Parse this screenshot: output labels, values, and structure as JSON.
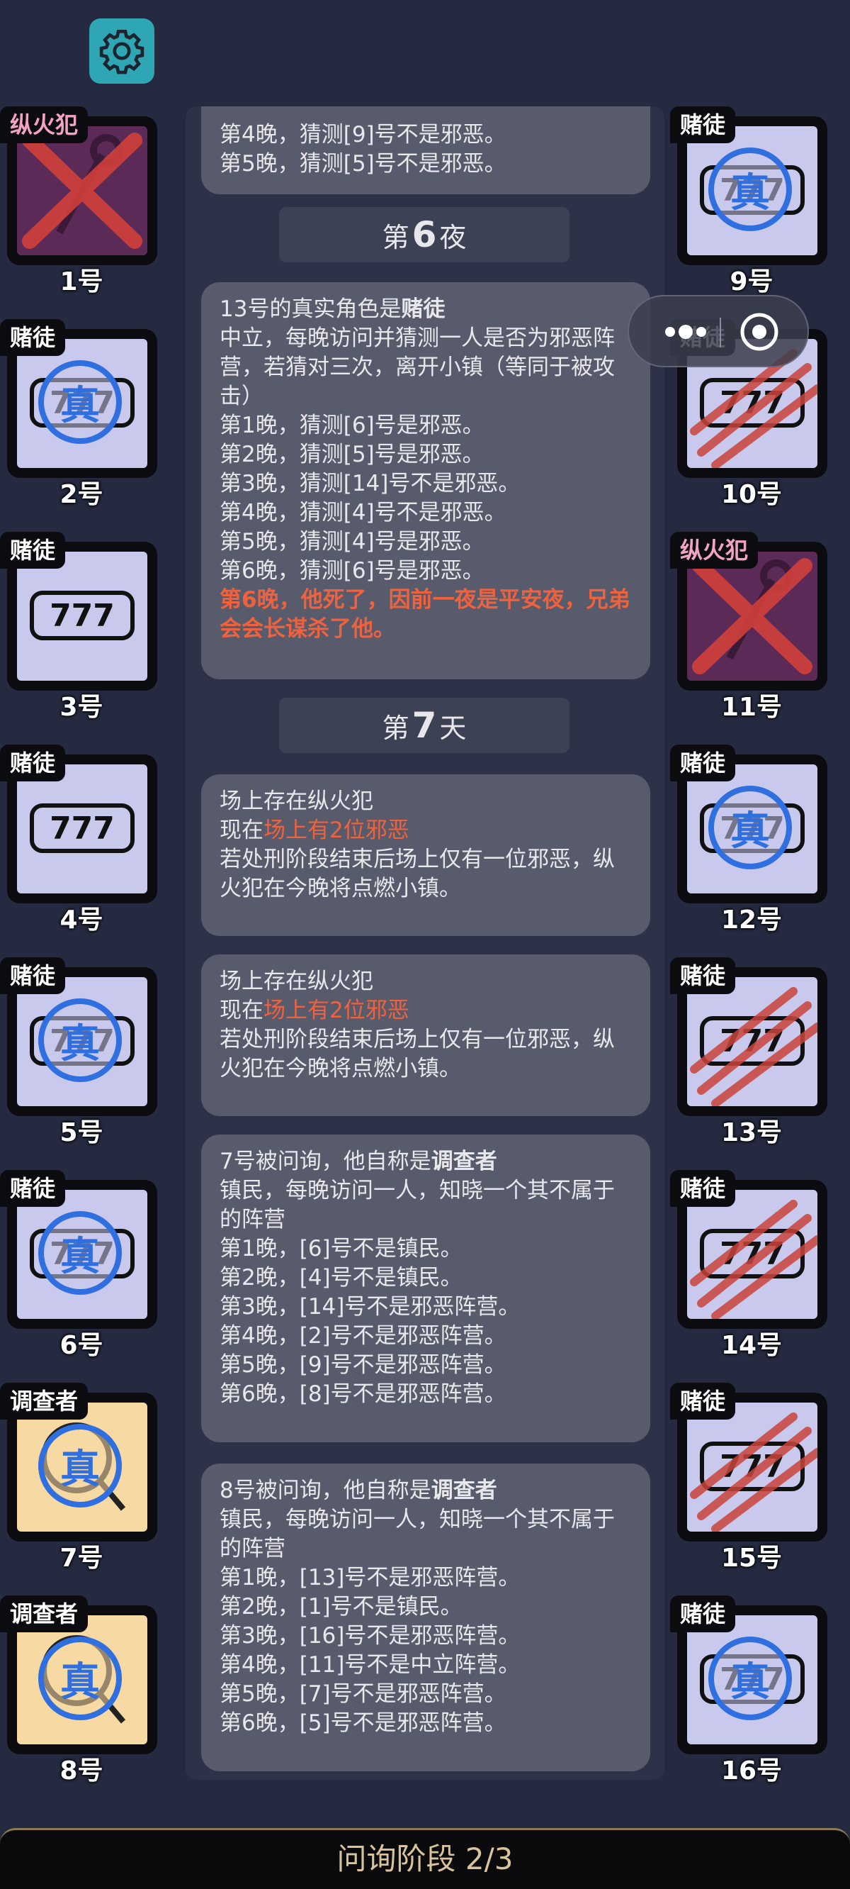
{
  "phase_label": "问询阶段 2/3",
  "icons": {
    "settings": "gear-icon",
    "more": "more-dots-icon",
    "close": "target-icon"
  },
  "colors": {
    "background": "#252a40",
    "card": "#585b6b",
    "accent_red": "#f0623d",
    "gambler_tile": "#c8c9ec",
    "arsonist_tile": "#5b2a57",
    "investigator_tile": "#f7d9a4",
    "verified_blue": "#2f6fe0"
  },
  "left_players": [
    {
      "number": "1号",
      "role": "纵火犯",
      "state": "dead"
    },
    {
      "number": "2号",
      "role": "赌徒",
      "state": "verified"
    },
    {
      "number": "3号",
      "role": "赌徒",
      "state": "normal"
    },
    {
      "number": "4号",
      "role": "赌徒",
      "state": "normal"
    },
    {
      "number": "5号",
      "role": "赌徒",
      "state": "verified"
    },
    {
      "number": "6号",
      "role": "赌徒",
      "state": "verified"
    },
    {
      "number": "7号",
      "role": "调查者",
      "state": "verified"
    },
    {
      "number": "8号",
      "role": "调查者",
      "state": "verified"
    }
  ],
  "right_players": [
    {
      "number": "9号",
      "role": "赌徒",
      "state": "verified"
    },
    {
      "number": "10号",
      "role": "赌徒",
      "state": "slashed"
    },
    {
      "number": "11号",
      "role": "纵火犯",
      "state": "dead"
    },
    {
      "number": "12号",
      "role": "赌徒",
      "state": "verified"
    },
    {
      "number": "13号",
      "role": "赌徒",
      "state": "slashed"
    },
    {
      "number": "14号",
      "role": "赌徒",
      "state": "slashed"
    },
    {
      "number": "15号",
      "role": "赌徒",
      "state": "slashed"
    },
    {
      "number": "16号",
      "role": "赌徒",
      "state": "verified"
    }
  ],
  "badge_text": "真",
  "slot_text": "777",
  "log": {
    "card0": {
      "line1": "第4晚，猜测[9]号不是邪恶。",
      "line2": "第5晚，猜测[5]号不是邪恶。"
    },
    "night6": {
      "prefix": "第",
      "number": "6",
      "suffix": "夜"
    },
    "card1": {
      "title_prefix": "13号的真实角色是",
      "title_role": "赌徒",
      "desc": "中立，每晚访问并猜测一人是否为邪恶阵营，若猜对三次，离开小镇（等同于被攻击）",
      "lines": [
        "第1晚，猜测[6]号是邪恶。",
        "第2晚，猜测[5]号是邪恶。",
        "第3晚，猜测[14]号不是邪恶。",
        "第4晚，猜测[4]号不是邪恶。",
        "第5晚，猜测[4]号是邪恶。",
        "第6晚，猜测[6]号是邪恶。"
      ],
      "death": "第6晚，他死了，因前一夜是平安夜，兄弟会会长谋杀了他。"
    },
    "day7": {
      "prefix": "第",
      "number": "7",
      "suffix": "天"
    },
    "card2": {
      "line1": "场上存在纵火犯",
      "prefix": "现在",
      "highlight": "场上有2位邪恶",
      "rest": "若处刑阶段结束后场上仅有一位邪恶，纵火犯在今晚将点燃小镇。"
    },
    "card3": {
      "line1": "场上存在纵火犯",
      "prefix": "现在",
      "highlight": "场上有2位邪恶",
      "rest": "若处刑阶段结束后场上仅有一位邪恶，纵火犯在今晚将点燃小镇。"
    },
    "card4": {
      "title_prefix": "7号被问询，他自称是",
      "title_role": "调查者",
      "desc": "镇民，每晚访问一人，知晓一个其不属于的阵营",
      "lines": [
        "第1晚，[6]号不是镇民。",
        "第2晚，[4]号不是镇民。",
        "第3晚，[14]号不是邪恶阵营。",
        "第4晚，[2]号不是邪恶阵营。",
        "第5晚，[9]号不是邪恶阵营。",
        "第6晚，[8]号不是邪恶阵营。"
      ]
    },
    "card5": {
      "title_prefix": "8号被问询，他自称是",
      "title_role": "调查者",
      "desc": "镇民，每晚访问一人，知晓一个其不属于的阵营",
      "lines": [
        "第1晚，[13]号不是邪恶阵营。",
        "第2晚，[1]号不是镇民。",
        "第3晚，[16]号不是邪恶阵营。",
        "第4晚，[11]号不是中立阵营。",
        "第5晚，[7]号不是邪恶阵营。",
        "第6晚，[5]号不是邪恶阵营。"
      ]
    }
  }
}
